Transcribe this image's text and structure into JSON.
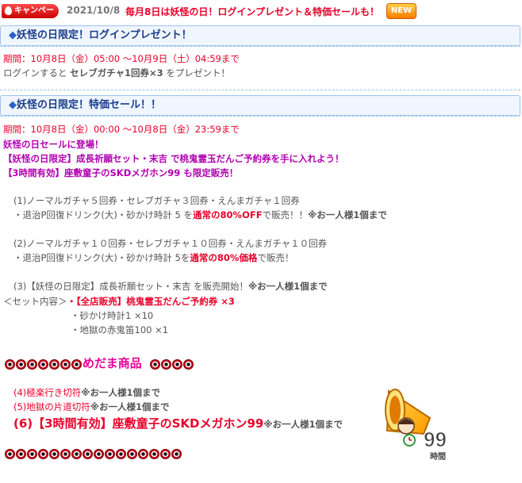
{
  "header": {
    "campaign_badge": "キャンペーン",
    "date": "2021/10/8",
    "title": "毎月8日は妖怪の日！ログインプレゼント＆特価セールも！",
    "new_badge": "NEW"
  },
  "section1": {
    "mark": "◆",
    "title": "妖怪の日限定！ログインプレゼント！",
    "period": "期間：10月8日（金）05:00 ～10月9日（土）04:59まで",
    "body_pre": "ログインすると ",
    "body_bold": "セレブガチャ1回券×3",
    "body_post": " をプレゼント！"
  },
  "section2": {
    "mark": "◆",
    "title": "妖怪の日限定！特価セール！！",
    "period": "期間：10月8日（金）00:00 ～10月8日（金）23:59まで",
    "intro": "妖怪の日セールに登場！",
    "line2": "【妖怪の日限定】成長祈願セット・末吉 で桃鬼霊玉だんご予約券を手に入れよう！",
    "line3": "【3時間有効】座敷童子のSKDメガホン99 も限定販売！",
    "item1_a": "(1)ノーマルガチャ５回券・セレブガチャ３回券・えんまガチャ１回券",
    "item1_b_pre": "・退治P回復ドリンク(大)・砂かけ時計  5  を",
    "item1_b_red": "通常の80%OFF",
    "item1_b_mid": "で販売！！",
    "item1_b_note": "※お一人様1個まで",
    "item2_a": "(2)ノーマルガチャ１０回券・セレブガチャ１０回券・えんまガチャ１０回券",
    "item2_b_pre": "・退治P回復ドリンク(大)・砂かけ時計  5を",
    "item2_b_red": "通常の80%価格",
    "item2_b_post": "で販売！",
    "item3_a_pre": "(3)【妖怪の日限定】成長祈願セット・末吉 を販売開始！",
    "item3_a_note": "※お一人様1個まで",
    "set_label": "＜セット内容＞",
    "set_1": "・【全店販売】桃鬼霊玉だんご予約券 ×3",
    "set_2": "・砂かけ時計1  ×10",
    "set_3": "・地獄の赤鬼笛100  ×1"
  },
  "medama": {
    "title": "めだま商品",
    "items": [
      {
        "idx": "(4)",
        "name": "極楽行き切符",
        "note": "※お一人様1個まで"
      },
      {
        "idx": "(5)",
        "name": "地獄の片道切符",
        "note": "※お一人様1個まで"
      },
      {
        "idx": "(6)",
        "name": "【3時間有効】座敷童子のSKDメガホン99",
        "note": "※お一人様1個まで"
      }
    ],
    "megaphone_number": "99",
    "megaphone_label": "時間"
  }
}
